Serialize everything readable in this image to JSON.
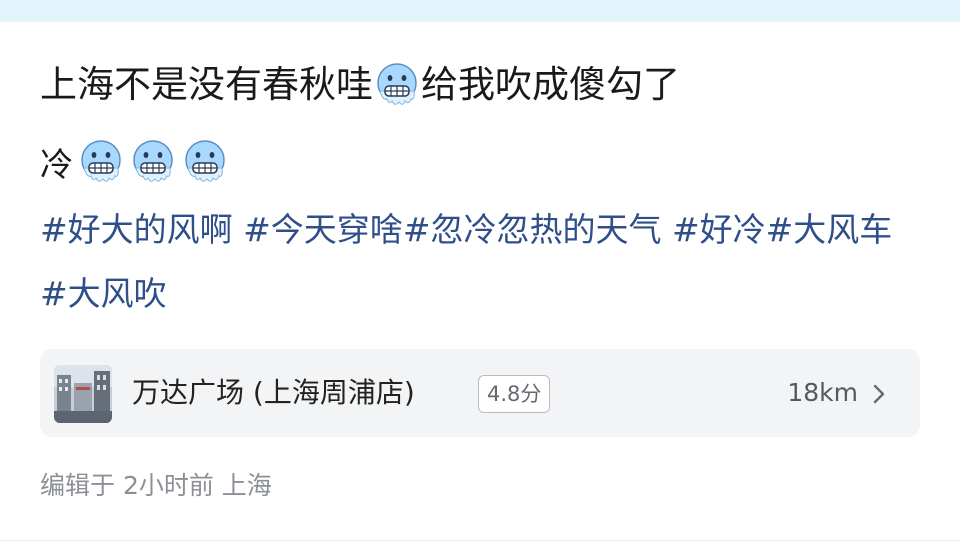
{
  "post": {
    "title_part1": "上海不是没有春秋哇",
    "title_part2": "给我吹成傻勾了",
    "line2_text": "冷",
    "emoji_icon": "cold-face-icon",
    "tags": [
      "#好大的风啊",
      "#今天穿啥",
      "#忽冷忽热的天气",
      "#好冷",
      "#大风车",
      "#大风吹"
    ]
  },
  "location_card": {
    "name": "万达广场 (上海周浦店)",
    "rating": "4.8分",
    "distance": "18km",
    "chevron_icon": "chevron-right-icon",
    "thumbnail_icon": "building-thumbnail"
  },
  "meta": {
    "text": "编辑于 2小时前 上海"
  },
  "colors": {
    "tag": "#2f4f8a",
    "top_strip": "#e3f3fb",
    "card_bg": "#f3f4f6",
    "emoji_face": "#a9d8ff"
  }
}
